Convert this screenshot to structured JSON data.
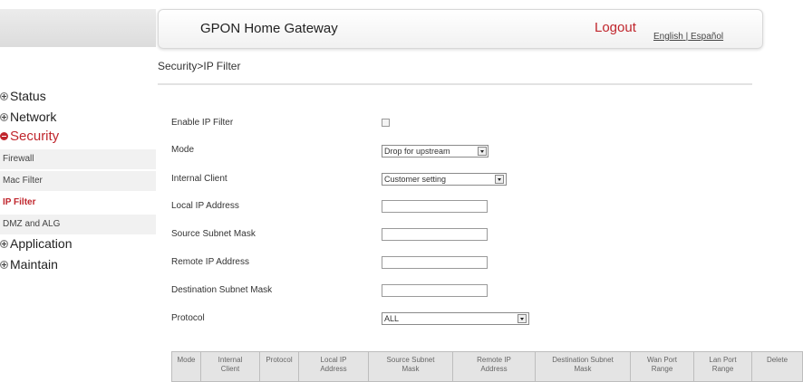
{
  "header": {
    "title": "GPON Home Gateway",
    "logout": "Logout",
    "lang_english": "English",
    "lang_sep": "|",
    "lang_spanish": "Español"
  },
  "breadcrumb": "Security>IP Filter",
  "sidebar": {
    "status": "Status",
    "network": "Network",
    "security": "Security",
    "firewall": "Firewall",
    "mac_filter": "Mac Filter",
    "ip_filter": "IP Filter",
    "dmz_alg": "DMZ and ALG",
    "application": "Application",
    "maintain": "Maintain"
  },
  "form": {
    "enable_label": "Enable IP Filter",
    "enable_checked": false,
    "mode_label": "Mode",
    "mode_value": "Drop for upstream",
    "client_label": "Internal Client",
    "client_value": "Customer setting",
    "local_ip_label": "Local IP Address",
    "local_ip_value": "",
    "source_mask_label": "Source Subnet Mask",
    "source_mask_value": "",
    "remote_ip_label": "Remote IP Address",
    "remote_ip_value": "",
    "dest_mask_label": "Destination Subnet Mask",
    "dest_mask_value": "",
    "protocol_label": "Protocol",
    "protocol_value": "ALL"
  },
  "table": {
    "columns": [
      {
        "l1": "Mode",
        "l2": ""
      },
      {
        "l1": "Internal",
        "l2": "Client"
      },
      {
        "l1": "Protocol",
        "l2": ""
      },
      {
        "l1": "Local IP",
        "l2": "Address"
      },
      {
        "l1": "Source Subnet",
        "l2": "Mask"
      },
      {
        "l1": "Remote IP",
        "l2": "Address"
      },
      {
        "l1": "Destination Subnet",
        "l2": "Mask"
      },
      {
        "l1": "Wan Port",
        "l2": "Range"
      },
      {
        "l1": "Lan Port",
        "l2": "Range"
      },
      {
        "l1": "Delete",
        "l2": ""
      }
    ]
  },
  "colors": {
    "accent": "#c0262d",
    "sub_bg": "#f1f1f1",
    "table_head_bg": "#e4e4e4"
  }
}
